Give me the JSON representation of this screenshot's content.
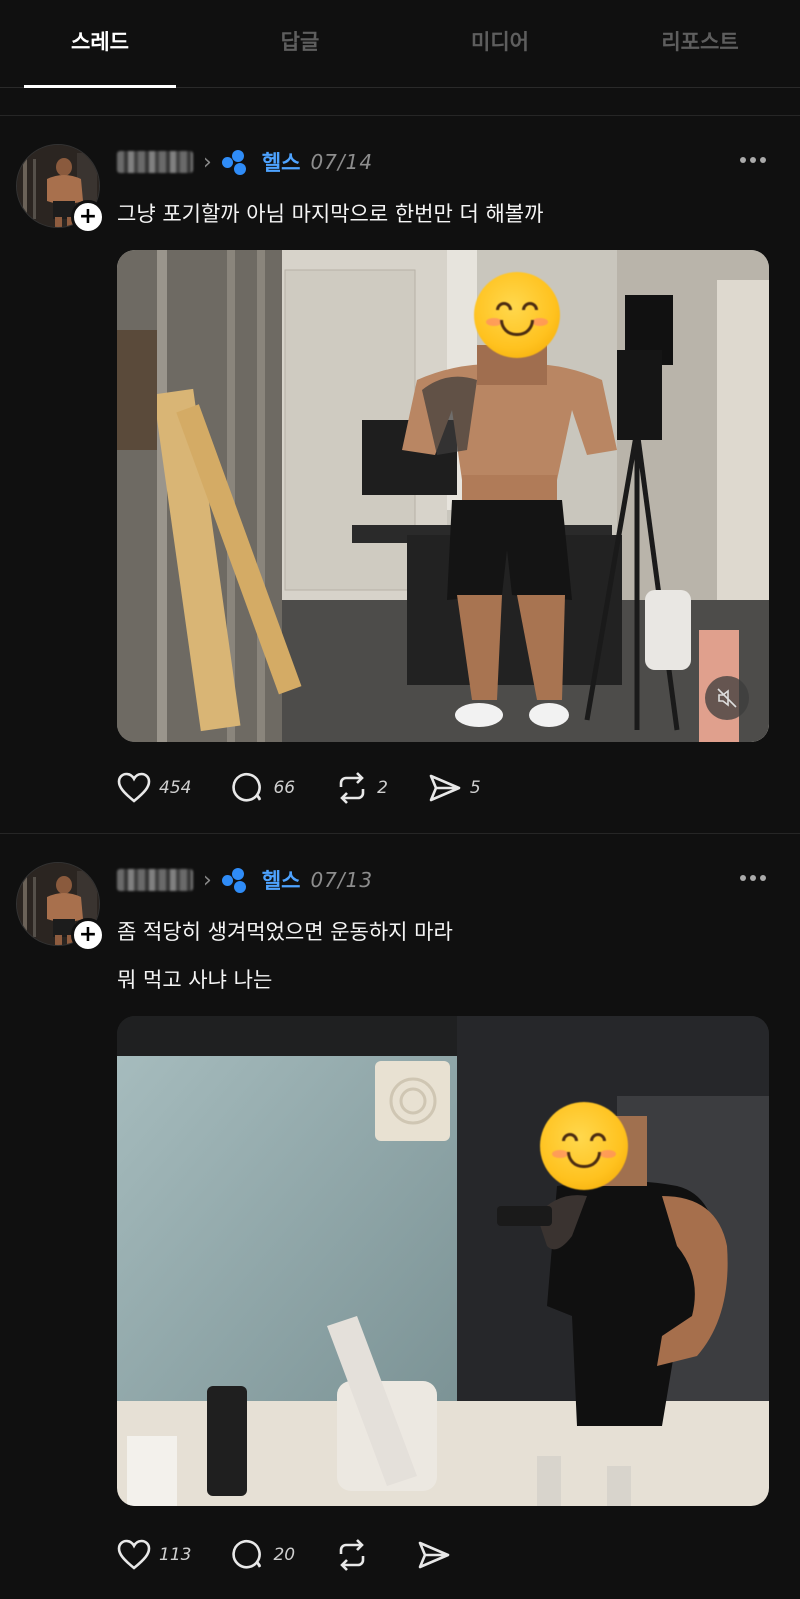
{
  "tabs": [
    {
      "label": "스레드",
      "active": true
    },
    {
      "label": "답글",
      "active": false
    },
    {
      "label": "미디어",
      "active": false
    },
    {
      "label": "리포스트",
      "active": false
    }
  ],
  "posts": [
    {
      "topic": "헬스",
      "date": "07/14",
      "text_lines": [
        "그냥 포기할까 아님 마지막으로 한번만 더 해볼까"
      ],
      "likes": "454",
      "replies": "66",
      "reposts": "2",
      "shares": "5"
    },
    {
      "topic": "헬스",
      "date": "07/13",
      "text_lines": [
        "좀 적당히 생겨먹었으면 운동하지 마라",
        "뭐 먹고 사냐 나는"
      ],
      "likes": "113",
      "replies": "20",
      "reposts": "",
      "shares": ""
    }
  ],
  "colors": {
    "background": "#101010",
    "topic_accent": "#4ea3ff",
    "text": "#f5f5f5",
    "muted": "#8d8d8d"
  },
  "icons": [
    "follow-plus-icon",
    "chevron-right-icon",
    "topic-icon",
    "more-icon",
    "heart-icon",
    "reply-icon",
    "repost-icon",
    "share-icon",
    "mute-icon"
  ]
}
